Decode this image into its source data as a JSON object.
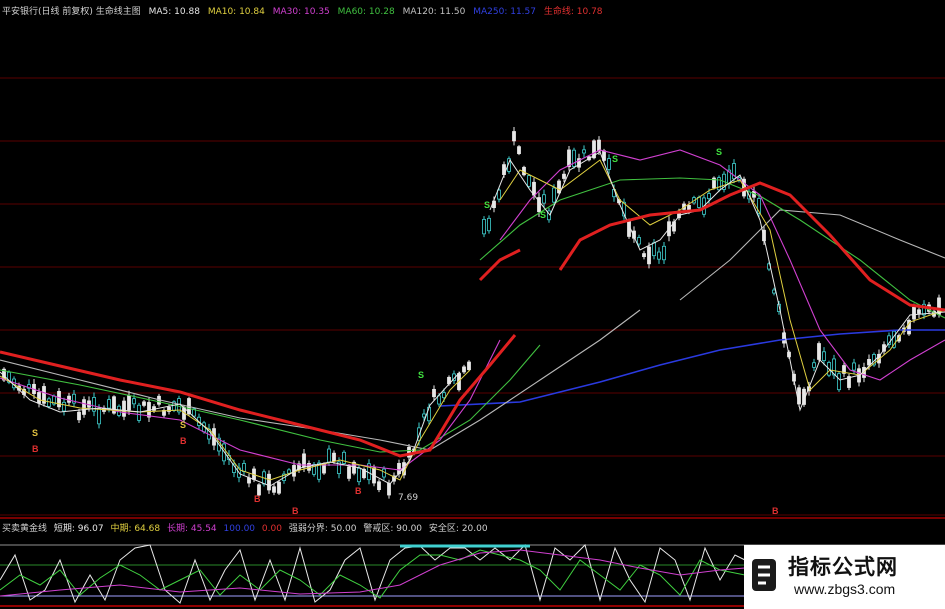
{
  "header": {
    "title": "平安银行(日线 前复权) 生命线主图",
    "ma5": "MA5: 10.88",
    "ma10": "MA10: 10.84",
    "ma30": "MA30: 10.35",
    "ma60": "MA60: 10.28",
    "ma120": "MA120: 11.50",
    "ma250": "MA250: 11.57",
    "lifeline": "生命线: 10.78"
  },
  "price_labels": {
    "low": "7.69"
  },
  "indicator": {
    "name": "买卖黄金线",
    "short_term": "短期: 96.07",
    "mid_term": "中期: 64.68",
    "long_term": "长期: 45.54",
    "val4": "100.00",
    "val5": "0.00",
    "strength_line": "强弱分界: 50.00",
    "alert_zone": "警戒区: 90.00",
    "safe_zone": "安全区: 20.00"
  },
  "watermark": {
    "title": "指标公式网",
    "url": "www.zbgs3.com"
  },
  "colors": {
    "background": "#000000",
    "lifeline": "#e02020",
    "ma5": "#e8e8e8",
    "ma10": "#e0d040",
    "ma30": "#d040d0",
    "ma60": "#40c040",
    "ma120": "#c0c0c0",
    "ma250": "#2030d0",
    "up_candle": "#40d0d0",
    "gridline": "#600000"
  }
}
